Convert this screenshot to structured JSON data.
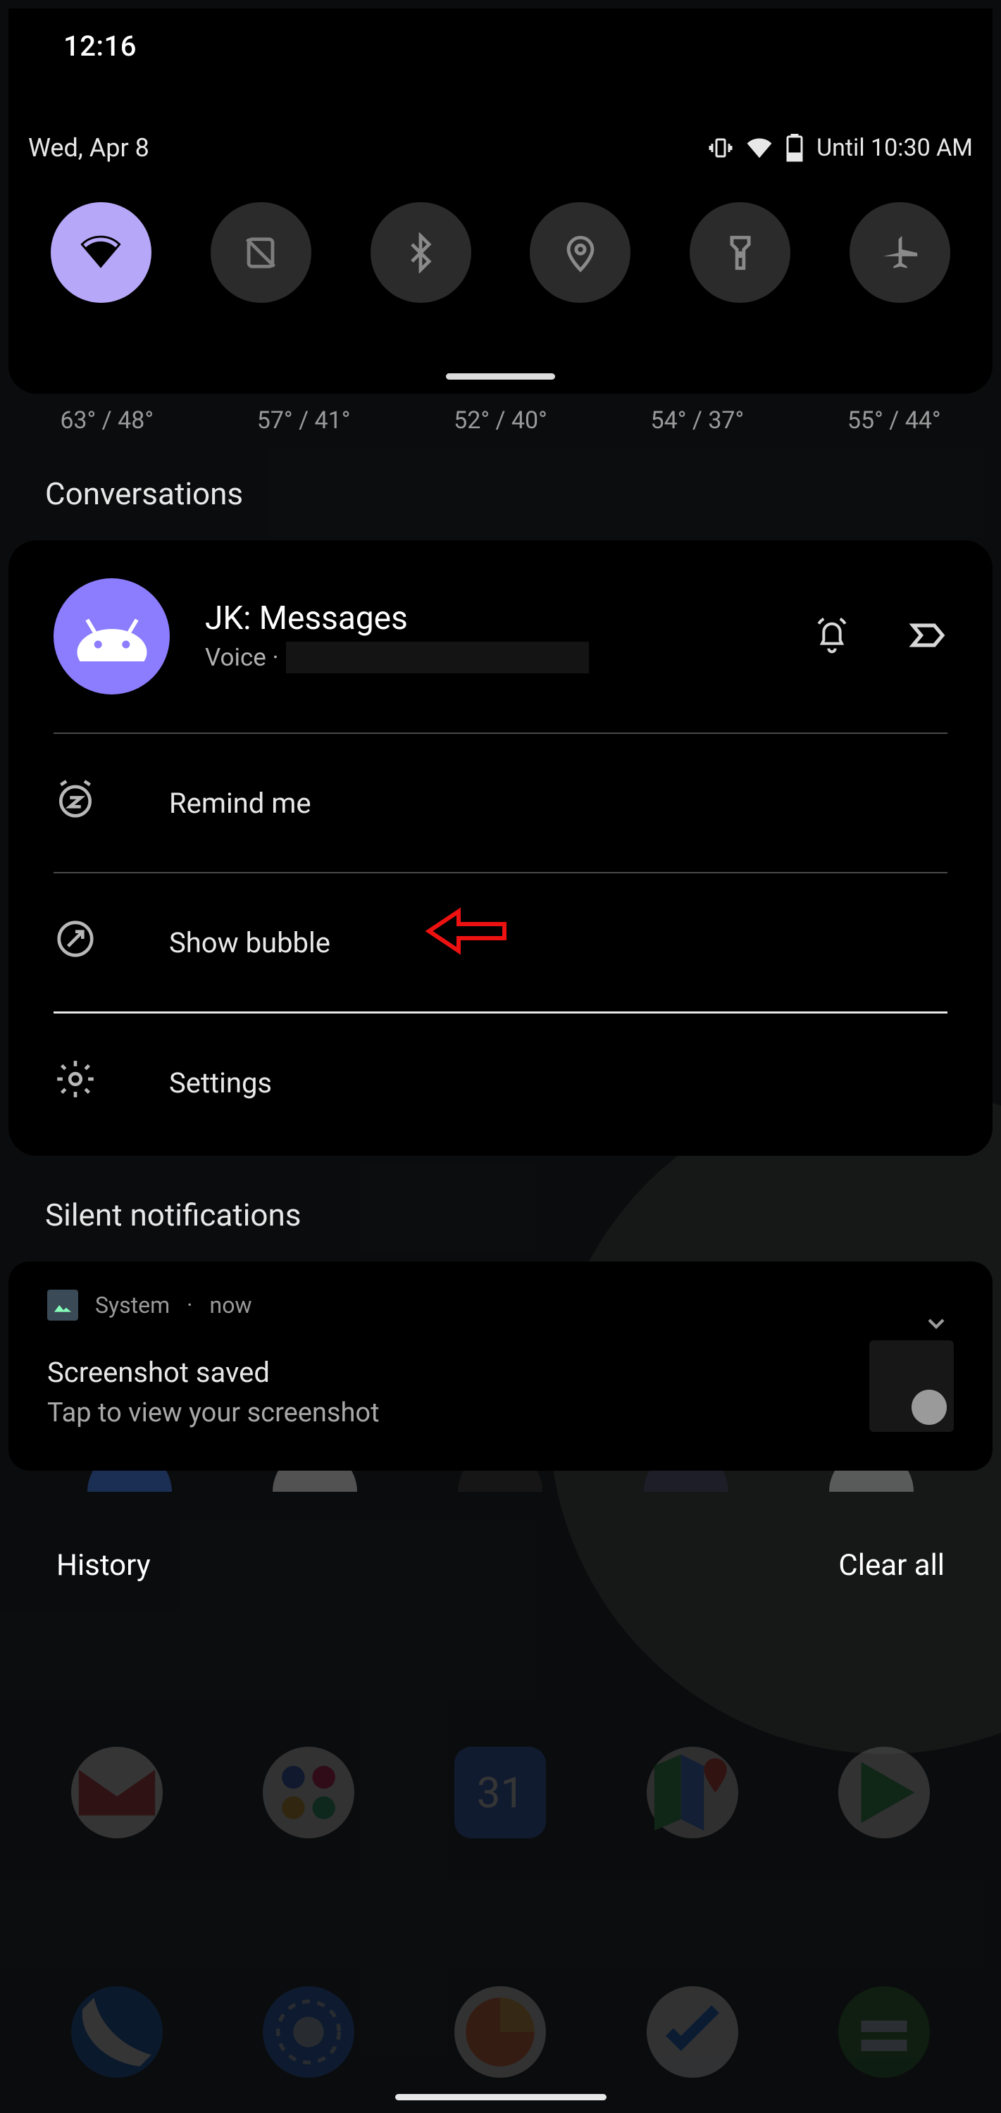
{
  "statusbar": {
    "time": "12:16",
    "date": "Wed, Apr 8",
    "alarm_text": "Until 10:30 AM"
  },
  "quick_settings": {
    "tiles": [
      {
        "name": "wifi",
        "active": true
      },
      {
        "name": "data",
        "active": false
      },
      {
        "name": "bluetooth",
        "active": false
      },
      {
        "name": "location",
        "active": false
      },
      {
        "name": "flashlight",
        "active": false
      },
      {
        "name": "airplane",
        "active": false
      }
    ]
  },
  "weather": [
    "63° / 48°",
    "57° / 41°",
    "52° / 40°",
    "54° / 37°",
    "55° / 44°"
  ],
  "sections": {
    "conversations": "Conversations",
    "silent": "Silent notifications"
  },
  "conversation": {
    "title": "JK: Messages",
    "subtitle_prefix": "Voice · ",
    "menu": {
      "remind": "Remind me",
      "bubble": "Show bubble",
      "settings": "Settings"
    }
  },
  "silent_notification": {
    "app": "System",
    "time_sep": "·",
    "time": "now",
    "title": "Screenshot saved",
    "body": "Tap to view your screenshot"
  },
  "footer": {
    "history": "History",
    "clear": "Clear all"
  }
}
